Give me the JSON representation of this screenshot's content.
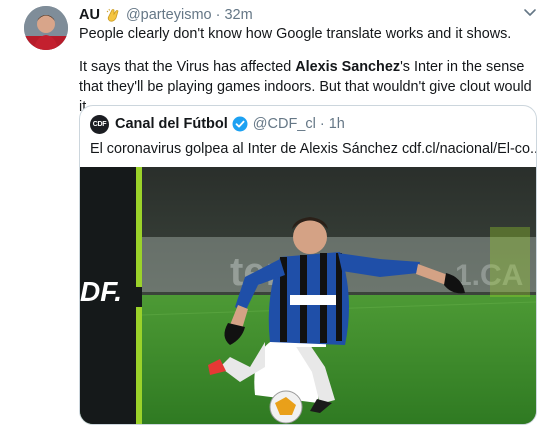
{
  "tweet": {
    "name": "AU",
    "handle": "@parteyismo",
    "separator": "·",
    "time": "32m",
    "line1": "People clearly don't know how Google translate works and it shows.",
    "line2_prefix": "It says that the Virus has affected ",
    "line2_bold": "Alexis Sanchez",
    "line2_suffix": "'s Inter in the sense that they'll be playing games indoors. But that wouldn't give clout would it.",
    "avatar_icon": "user-avatar-photo",
    "badge_icon": "clapping-hands-icon",
    "menu_icon": "chevron-down-icon"
  },
  "quote": {
    "avatar_text": "CDF",
    "name": "Canal del Fútbol",
    "verified_icon": "verified-badge-icon",
    "handle": "@CDF_cl",
    "separator": "·",
    "time": "1h",
    "text": "El coronavirus golpea al Inter de Alexis Sánchez  cdf.cl/nacional/El-co...",
    "media_logo": "DF."
  },
  "colors": {
    "text": "#14171a",
    "muted": "#657786",
    "border": "#ccd6dd",
    "verified": "#1da1f2",
    "pitch": "#3f8a2e",
    "jersey_blue": "#1f4fa8"
  }
}
